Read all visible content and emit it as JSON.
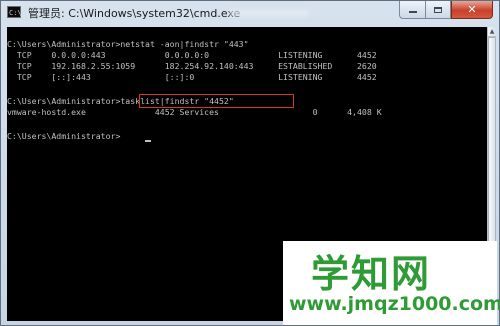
{
  "window": {
    "icon_text": "C:\\",
    "title": "管理员: C:\\Windows\\system32\\cmd.exe",
    "close_glyph": "✕"
  },
  "console": {
    "lines": [
      "C:\\Users\\Administrator>netstat -aon|findstr \"443\"",
      "  TCP    0.0.0.0:443            0.0.0.0:0              LISTENING       4452",
      "  TCP    192.168.2.55:1059      182.254.92.140:443     ESTABLISHED     2620",
      "  TCP    [::]:443               [::]:0                 LISTENING       4452",
      "",
      "C:\\Users\\Administrator>tasklist|findstr \"4452\"",
      "vmware-hostd.exe              4452 Services                   0      4,408 K",
      "",
      "C:\\Users\\Administrator>"
    ]
  },
  "watermark": {
    "chinese": "学知网",
    "url": "www.jmqz1000.com"
  },
  "colors": {
    "console_bg": "#000000",
    "console_text": "#c0c0c0",
    "highlight": "#d23a1e",
    "watermark_green": "#2f9b35"
  }
}
